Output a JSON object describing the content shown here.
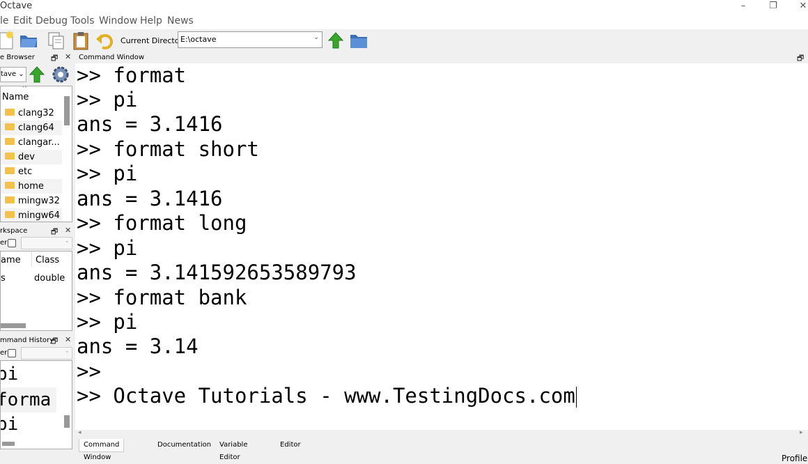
{
  "window": {
    "title": "Octave"
  },
  "menu": [
    "le",
    "Edit",
    "Debug",
    "Tools",
    "Window",
    "Help",
    "News"
  ],
  "toolbar": {
    "current_directory_label": "Current Directory:",
    "current_directory_value": "E:\\octave"
  },
  "file_browser": {
    "title": "e Browser",
    "path": "tave",
    "column_name": "Name",
    "items": [
      "clang32",
      "clang64",
      "clangar...",
      "dev",
      "etc",
      "home",
      "mingw32",
      "mingw64"
    ]
  },
  "workspace": {
    "title": "rkspace",
    "filter_label": "er",
    "columns": [
      "ame",
      "Class"
    ],
    "rows": [
      {
        "name": "s",
        "class": "double"
      }
    ]
  },
  "command_history": {
    "title": "mmand History",
    "filter_label": "er",
    "items": [
      "pi",
      "forma",
      "pi"
    ]
  },
  "command_window": {
    "title": "Command Window",
    "lines": [
      ">> format",
      ">> pi",
      "ans = 3.1416",
      ">> format short",
      ">> pi",
      "ans = 3.1416",
      ">> format long",
      ">> pi",
      "ans = 3.141592653589793",
      ">> format bank",
      ">> pi",
      "ans = 3.14",
      ">>",
      ">> Octave Tutorials - www.TestingDocs.com"
    ]
  },
  "tabs": [
    "Command Window",
    "Documentation",
    "Variable Editor",
    "Editor"
  ],
  "status": {
    "right": "Profile"
  },
  "colors": {
    "folder": "#f2c14e",
    "arrow_green": "#3aa52b",
    "folder_blue": "#4a7fc1"
  }
}
